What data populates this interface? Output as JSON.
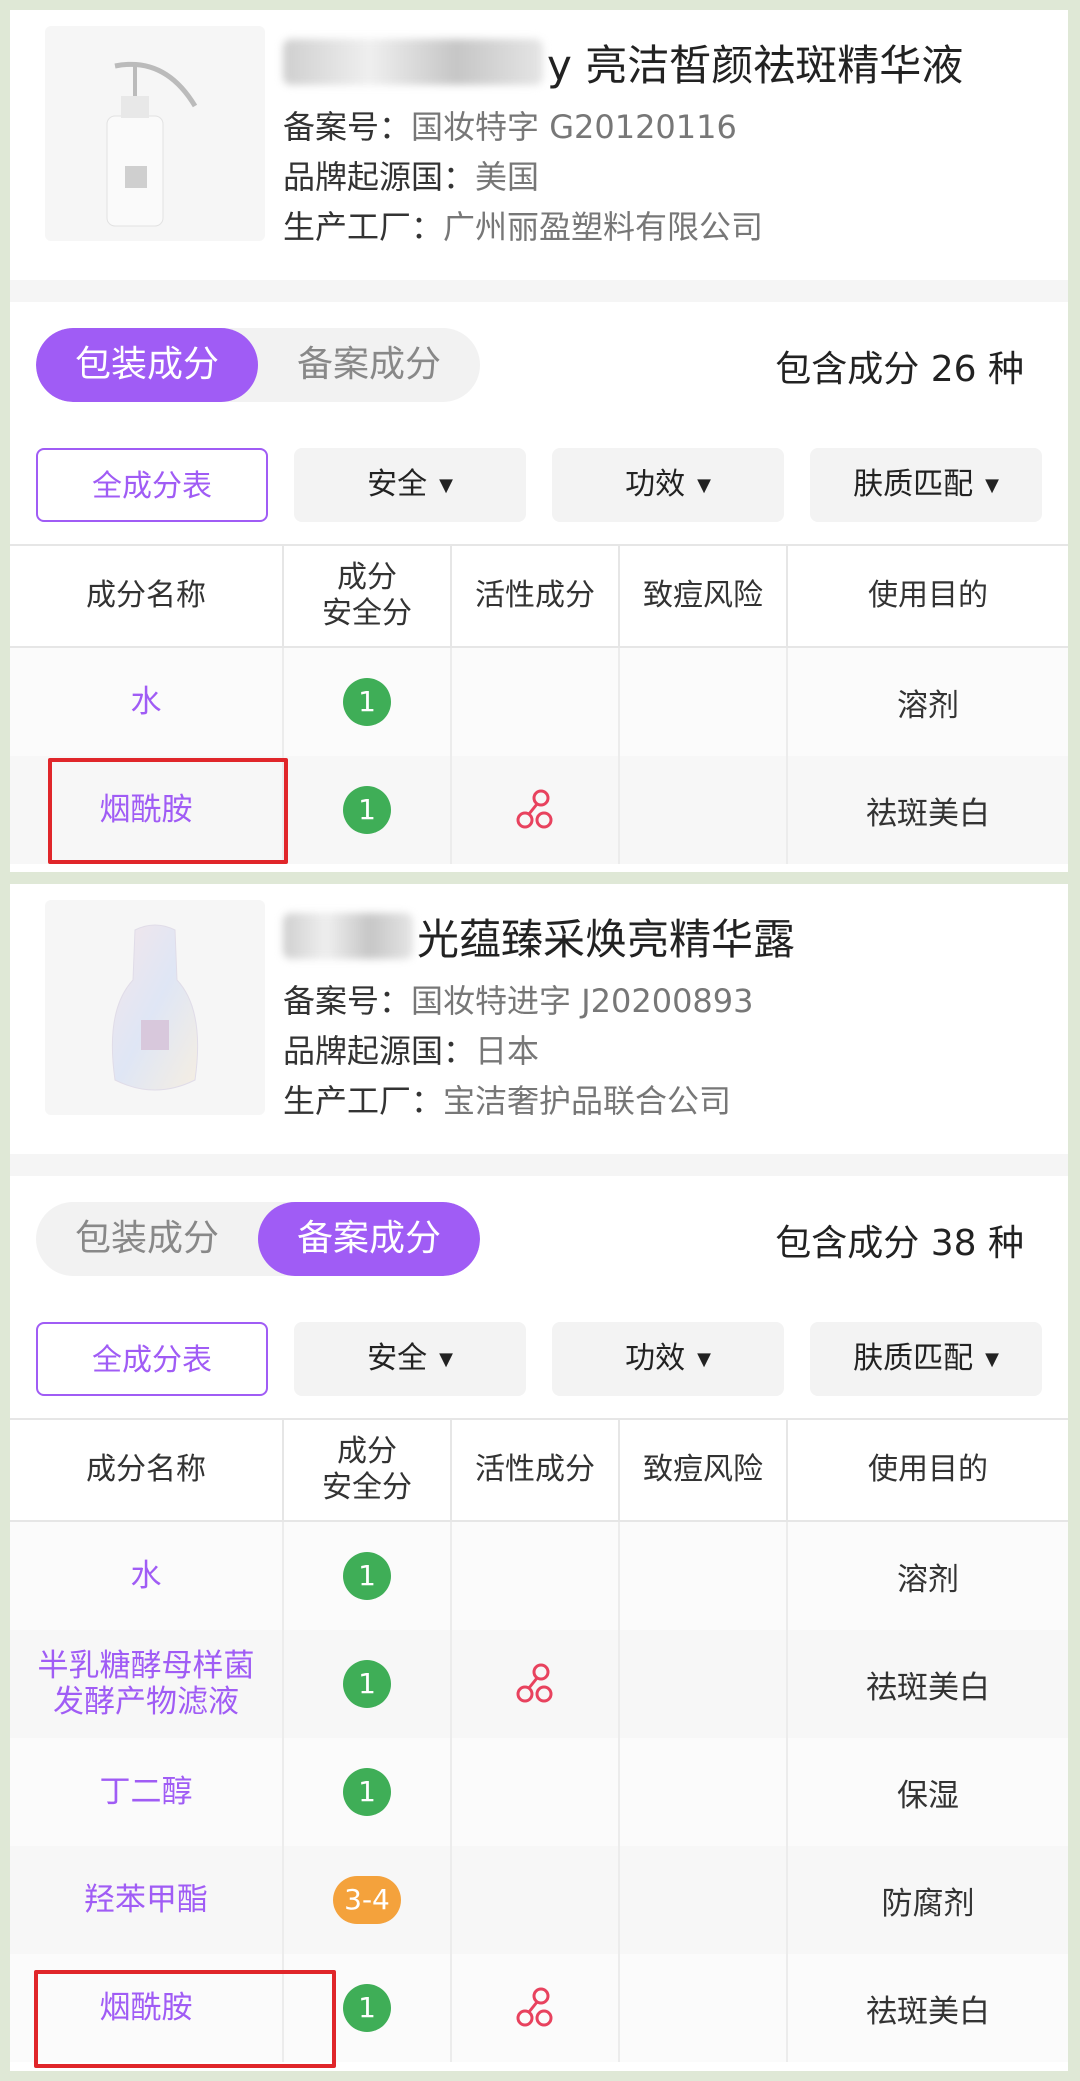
{
  "products": [
    {
      "name": "y 亮洁皙颜祛斑精华液",
      "registration_label": "备案号：",
      "registration": "国妆特字 G20120116",
      "origin_label": "品牌起源国：",
      "origin": "美国",
      "factory_label": "生产工厂：",
      "factory": "广州丽盈塑料有限公司",
      "tabs": [
        "包装成分",
        "备案成分"
      ],
      "active_tab": 0,
      "count_text": "包含成分 26 种",
      "filters": [
        "全成分表",
        "安全",
        "功效",
        "肤质匹配"
      ],
      "columns": [
        "成分名称",
        "成分\n安全分",
        "活性成分",
        "致痘风险",
        "使用目的"
      ],
      "rows": [
        {
          "name": "水",
          "score": "1",
          "active": false,
          "purpose": "溶剂"
        },
        {
          "name": "烟酰胺",
          "score": "1",
          "active": true,
          "purpose": "祛斑美白"
        }
      ]
    },
    {
      "name": "光蕴臻采焕亮精华露",
      "registration_label": "备案号：",
      "registration": "国妆特进字 J20200893",
      "origin_label": "品牌起源国：",
      "origin": "日本",
      "factory_label": "生产工厂：",
      "factory": "宝洁奢护品联合公司",
      "tabs": [
        "包装成分",
        "备案成分"
      ],
      "active_tab": 1,
      "count_text": "包含成分 38 种",
      "filters": [
        "全成分表",
        "安全",
        "功效",
        "肤质匹配"
      ],
      "columns": [
        "成分名称",
        "成分\n安全分",
        "活性成分",
        "致痘风险",
        "使用目的"
      ],
      "rows": [
        {
          "name": "水",
          "score": "1",
          "active": false,
          "purpose": "溶剂"
        },
        {
          "name": "半乳糖酵母样菌\n发酵产物滤液",
          "score": "1",
          "active": true,
          "purpose": "祛斑美白"
        },
        {
          "name": "丁二醇",
          "score": "1",
          "active": false,
          "purpose": "保湿"
        },
        {
          "name": "羟苯甲酯",
          "score": "3-4",
          "active": false,
          "purpose": "防腐剂"
        },
        {
          "name": "烟酰胺",
          "score": "1",
          "active": true,
          "purpose": "祛斑美白"
        }
      ]
    }
  ],
  "icons": {
    "active_ingredient": "active-ingredient-icon",
    "dropdown": "caret-down-icon"
  },
  "colors": {
    "accent": "#a05cf5",
    "safe": "#3fae57",
    "warn": "#f4a23c",
    "highlight": "#e0262a"
  }
}
